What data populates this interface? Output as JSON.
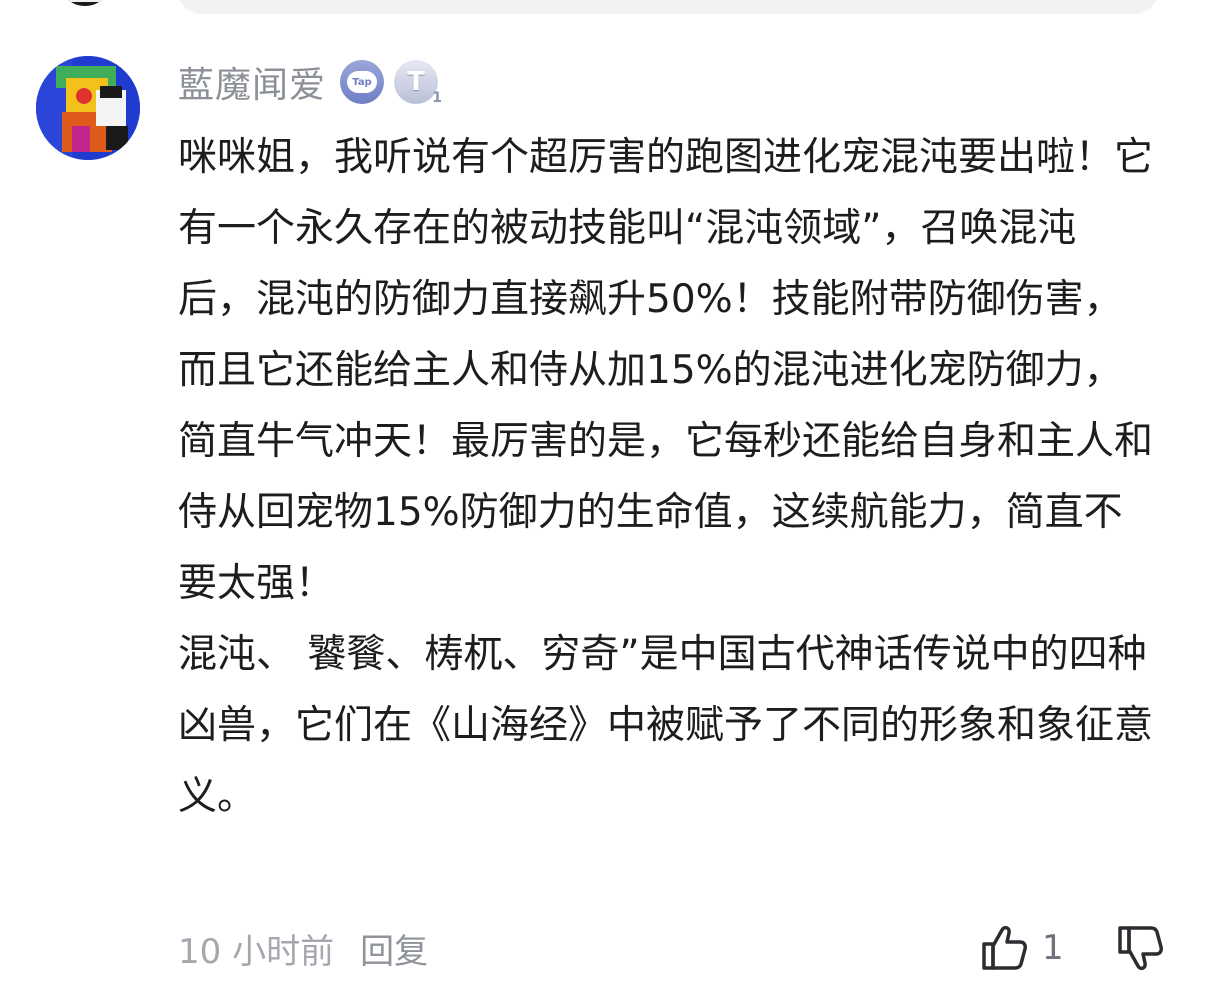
{
  "comment": {
    "username": "藍魔闻爱",
    "badges": {
      "tap_label": "Tap",
      "level_letter": "T",
      "level_number": "1"
    },
    "paragraphs": [
      "咪咪姐，我听说有个超厉害的跑图进化宠混沌要出啦！它有一个永久存在的被动技能叫“混沌领域”，召唤混沌后，混沌的防御力直接飙升50%！技能附带防御伤害，而且它还能给主人和侍从加15%的混沌进化宠防御力，简直牛气冲天！最厉害的是，它每秒还能给自身和主人和侍从回宠物15%防御力的生命值，这续航能力，简直不要太强！",
      "混沌、 饕餮、梼杌、穷奇”是中国古代神话传说中的四种凶兽，它们在《山海经》中被赋予了不同的形象和象征意义。"
    ],
    "time": "10 小时前",
    "reply_label": "回复",
    "like_count": "1"
  },
  "icons": {
    "like": "thumbs-up-icon",
    "dislike": "thumbs-down-icon"
  },
  "colors": {
    "username": "#8b8f96",
    "text": "#1d1d1f",
    "meta": "#a4a8ae",
    "badge_tap": "#6f7fc6",
    "avatar_bg": "#233cc9"
  }
}
